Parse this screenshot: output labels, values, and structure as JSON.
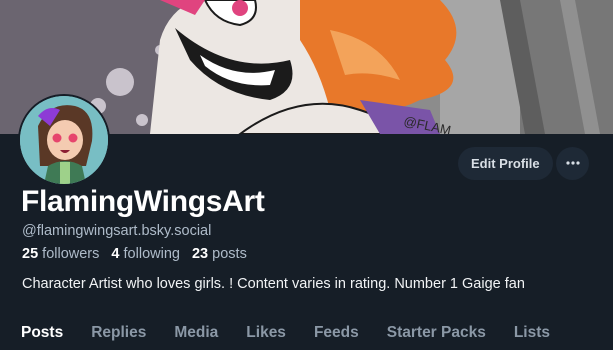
{
  "profile": {
    "display_name": "FlamingWingsArt",
    "handle": "@flamingwingsart.bsky.social",
    "bio": "Character Artist who loves girls. ! Content varies in rating. Number 1 Gaige fan",
    "banner_watermark": "@FLAM"
  },
  "stats": {
    "followers_count": "25",
    "followers_label": "followers",
    "following_count": "4",
    "following_label": "following",
    "posts_count": "23",
    "posts_label": "posts"
  },
  "actions": {
    "edit_profile_label": "Edit Profile",
    "more_icon": "more-horizontal-icon"
  },
  "tabs": [
    {
      "label": "Posts",
      "active": true
    },
    {
      "label": "Replies",
      "active": false
    },
    {
      "label": "Media",
      "active": false
    },
    {
      "label": "Likes",
      "active": false
    },
    {
      "label": "Feeds",
      "active": false
    },
    {
      "label": "Starter Packs",
      "active": false
    },
    {
      "label": "Lists",
      "active": false
    }
  ],
  "colors": {
    "background": "#161e27",
    "button_bg": "#1e2936",
    "muted_text": "#aebbc9",
    "tab_inactive": "#8b98a6"
  }
}
